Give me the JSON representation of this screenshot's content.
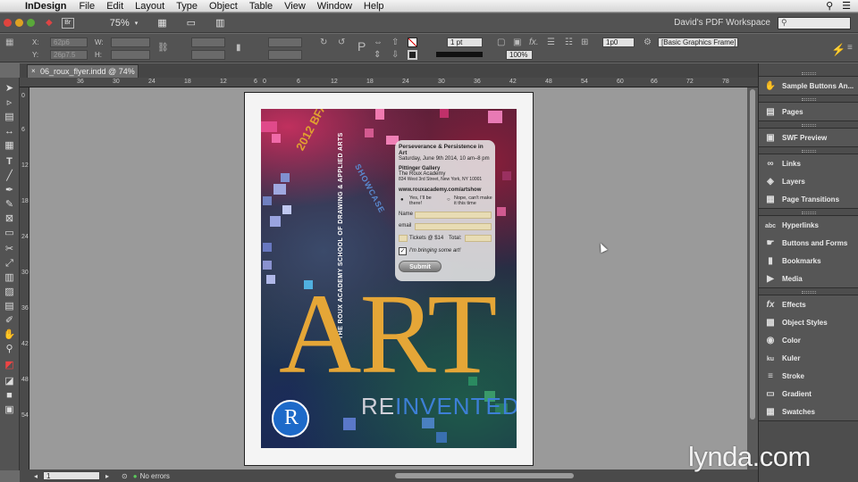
{
  "menubar": {
    "apple": "",
    "app": "InDesign",
    "items": [
      "File",
      "Edit",
      "Layout",
      "Type",
      "Object",
      "Table",
      "View",
      "Window",
      "Help"
    ],
    "right": [
      "⚲",
      "☰"
    ]
  },
  "appbar": {
    "zoom": "75%",
    "workspace": "David's PDF Workspace",
    "search_placeholder": ""
  },
  "control": {
    "x_label": "X:",
    "y_label": "Y:",
    "w_label": "W:",
    "h_label": "H:",
    "x": "62p6",
    "y": "26p7.5",
    "stroke_weight": "1 pt",
    "scale": "100%",
    "offset": "1p0",
    "frame_style": "[Basic Graphics Frame]"
  },
  "document": {
    "tab_title": "06_roux_flyer.indd @ 74%"
  },
  "ruler": {
    "h": [
      "36",
      "30",
      "24",
      "18",
      "12",
      "6",
      "0",
      "6",
      "12",
      "18",
      "24",
      "30",
      "36",
      "42",
      "48",
      "54",
      "60",
      "66",
      "72",
      "78"
    ],
    "v": [
      "0",
      "6",
      "12",
      "18",
      "24",
      "30",
      "36",
      "42",
      "48",
      "54"
    ]
  },
  "status": {
    "page": "1",
    "errors": "No errors"
  },
  "poster": {
    "bfa": "2012 BFA",
    "showcase": "SHOWCASE",
    "school": "THE ROUX ACADEMY SCHOOL OF DRAWING & APPLIED ARTS",
    "art": "ART",
    "re": "RE",
    "invented": "INVENTED",
    "seal_letter": "R"
  },
  "form": {
    "title": "Perseverance & Persistence in Art",
    "date": "Saturday, June 9th 2014, 10 am–8 pm",
    "gallery": "Pittinger Gallery",
    "venue": "The Roux Academy",
    "address": "834 West 3rd Street, New York, NY 10001",
    "url": "www.rouxacademy.com/artshow",
    "yes": "Yes, I'll be there!",
    "no": "Nope, can't make it this time",
    "name": "Name",
    "email": "email",
    "tickets": "Tickets @ $14",
    "total": "Total:",
    "bringing": "I'm bringing some art!",
    "submit": "Submit"
  },
  "panels": [
    {
      "icon": "✋",
      "label": "Sample Buttons An..."
    },
    {
      "icon": "▤",
      "label": "Pages"
    },
    {
      "icon": "▣",
      "label": "SWF Preview"
    },
    {
      "icon": "∞",
      "label": "Links"
    },
    {
      "icon": "◈",
      "label": "Layers"
    },
    {
      "icon": "▦",
      "label": "Page Transitions"
    },
    {
      "icon": "abc",
      "label": "Hyperlinks"
    },
    {
      "icon": "☛",
      "label": "Buttons and Forms"
    },
    {
      "icon": "▮",
      "label": "Bookmarks"
    },
    {
      "icon": "▶",
      "label": "Media"
    },
    {
      "icon": "fx",
      "label": "Effects"
    },
    {
      "icon": "▩",
      "label": "Object Styles"
    },
    {
      "icon": "◉",
      "label": "Color"
    },
    {
      "icon": "ku",
      "label": "Kuler"
    },
    {
      "icon": "≡",
      "label": "Stroke"
    },
    {
      "icon": "▭",
      "label": "Gradient"
    },
    {
      "icon": "▦",
      "label": "Swatches"
    }
  ],
  "watermark": "lynda.com"
}
